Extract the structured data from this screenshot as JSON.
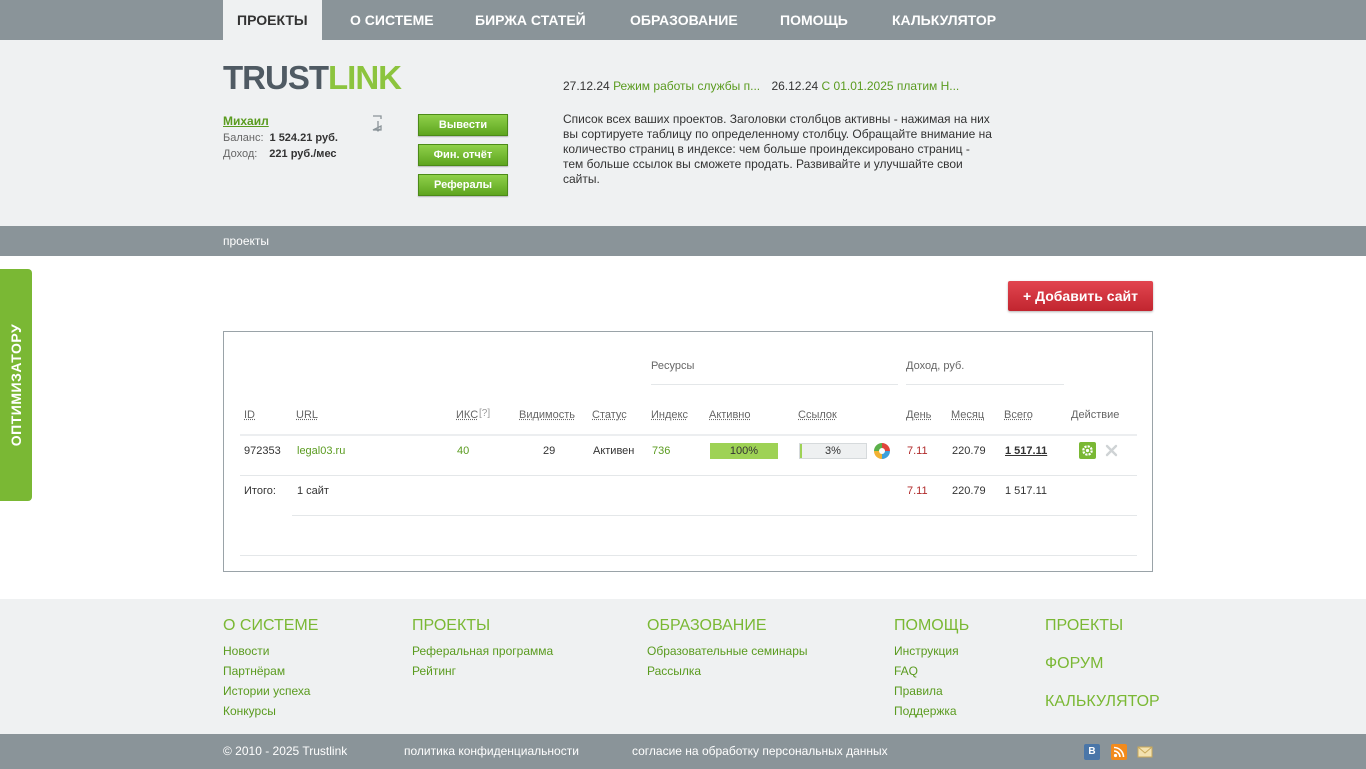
{
  "topnav": [
    {
      "label": "Проекты",
      "active": true
    },
    {
      "label": "О системе"
    },
    {
      "label": "Биржа статей"
    },
    {
      "label": "Образование"
    },
    {
      "label": "Помощь"
    },
    {
      "label": "Калькулятор"
    }
  ],
  "logo": {
    "part1": "TRUST",
    "part2": "LINK"
  },
  "user": {
    "name": "Михаил",
    "balance_label": "Баланс:",
    "balance_value": "1 524.21  руб.",
    "income_label": "Доход:",
    "income_value": "221 руб./мес"
  },
  "buttons": {
    "withdraw": "Вывести",
    "fin_report": "Фин. отчёт",
    "referrals": "Рефералы"
  },
  "news": [
    {
      "date": "27.12.24",
      "title": "Режим работы службы п..."
    },
    {
      "date": "26.12.24",
      "title": "С 01.01.2025 платим Н..."
    }
  ],
  "description": "Список всех ваших проектов. Заголовки столбцов активны - нажимая на них вы сортируете таблицу по определенному столбцу. Обращайте внимание на количество страниц в индексе: чем больше проиндексировано страниц - тем больше ссылок вы сможете продать. Развивайте и улучшайте свои сайты.",
  "breadcrumb": "проекты",
  "side_tab": "ОПТИМИЗАТОРУ",
  "add_site": "+ Добавить сайт",
  "table": {
    "group_resources": "Ресурсы",
    "group_income": "Доход,  руб.",
    "headers": {
      "id": "ID",
      "url": "URL",
      "iks": "ИКС",
      "iks_help": "[?]",
      "visibility": "Видимость",
      "status": "Статус",
      "index": "Индекс",
      "active": "Активно",
      "links": "Ссылок",
      "day": "День",
      "month": "Месяц",
      "total": "Всего",
      "action": "Действие"
    },
    "rows": [
      {
        "id": "972353",
        "url": "legal03.ru",
        "iks": "40",
        "visibility": "29",
        "status": "Активен",
        "index": "736",
        "active": "100%",
        "active_fraction": 1.0,
        "links": "3%",
        "links_fraction": 0.03,
        "day": "7.11",
        "month": "220.79",
        "total": "1 517.11"
      }
    ],
    "totals": {
      "label": "Итого:",
      "sites": "1 сайт",
      "day": "7.11",
      "month": "220.79",
      "total": "1 517.11"
    }
  },
  "footer": {
    "col1": {
      "title": "О системе",
      "links": [
        "Новости",
        "Партнёрам",
        "Истории успеха",
        "Конкурсы"
      ]
    },
    "col2": {
      "title": "Проекты",
      "links": [
        "Реферальная программа",
        "Рейтинг"
      ]
    },
    "col3": {
      "title": "Образование",
      "links": [
        "Образовательные семинары",
        "Рассылка"
      ]
    },
    "col4": {
      "title": "Помощь",
      "links": [
        "Инструкция",
        "FAQ",
        "Правила",
        "Поддержка"
      ]
    },
    "col5": [
      "ПРОЕКТЫ",
      "ФОРУМ",
      "КАЛЬКУЛЯТОР"
    ]
  },
  "bottom": {
    "copyright": "© 2010 - 2025 Trustlink",
    "privacy": "политика конфиденциальности",
    "consent": "согласие на обработку персональных данных"
  },
  "colors": {
    "accent_green": "#7ab834",
    "nav_gray": "#8a9499",
    "header_bg": "#eff1f2",
    "add_red": "#d0313b"
  }
}
